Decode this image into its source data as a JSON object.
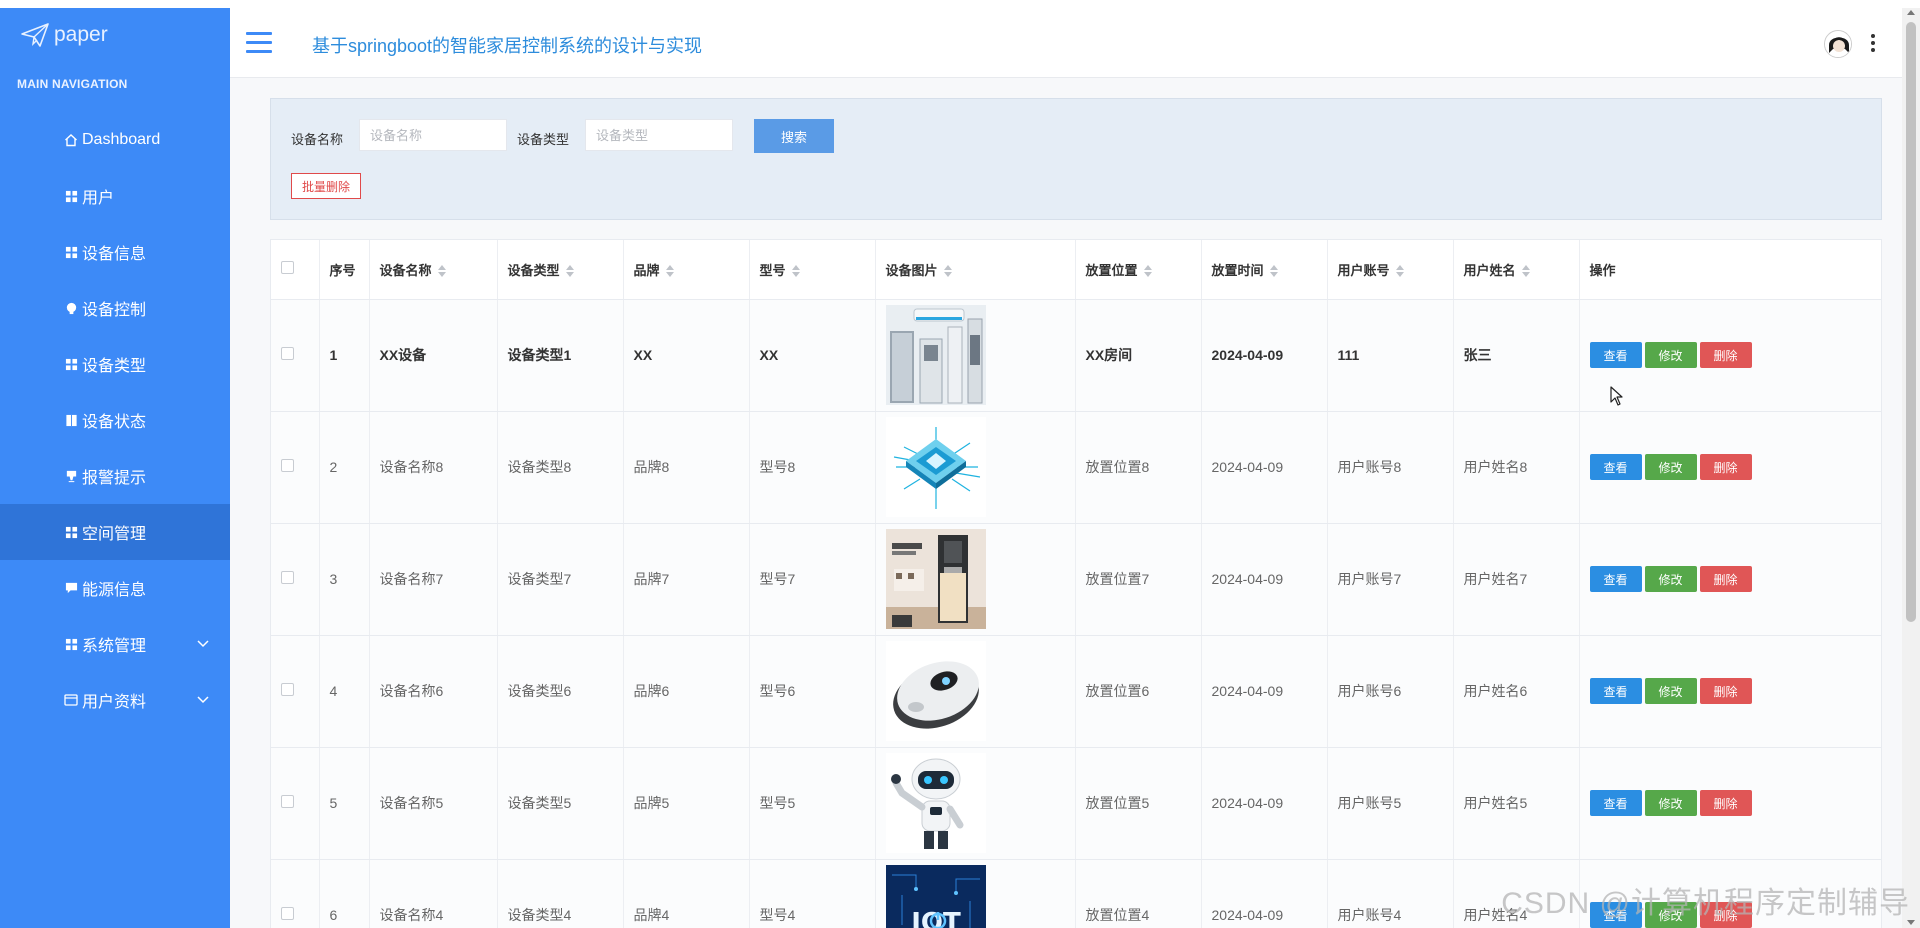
{
  "brand": {
    "name": "paper"
  },
  "sidebar": {
    "section_title": "MAIN NAVIGATION",
    "items": [
      {
        "label": "Dashboard",
        "icon": "home-icon"
      },
      {
        "label": "用户",
        "icon": "grid-icon"
      },
      {
        "label": "设备信息",
        "icon": "grid-icon"
      },
      {
        "label": "设备控制",
        "icon": "bulb-icon"
      },
      {
        "label": "设备类型",
        "icon": "grid-icon"
      },
      {
        "label": "设备状态",
        "icon": "book-icon"
      },
      {
        "label": "报警提示",
        "icon": "cup-icon"
      },
      {
        "label": "空间管理",
        "icon": "grid-icon",
        "active": true
      },
      {
        "label": "能源信息",
        "icon": "chat-icon"
      },
      {
        "label": "系统管理",
        "icon": "grid-icon",
        "expandable": true
      },
      {
        "label": "用户资料",
        "icon": "id-card-icon",
        "expandable": true
      }
    ]
  },
  "header": {
    "title": "基于springboot的智能家居控制系统的设计与实现"
  },
  "search": {
    "name_label": "设备名称",
    "name_placeholder": "设备名称",
    "type_label": "设备类型",
    "type_placeholder": "设备类型",
    "search_button": "搜索",
    "batch_delete_button": "批量删除"
  },
  "table": {
    "columns": [
      "",
      "序号",
      "设备名称",
      "设备类型",
      "品牌",
      "型号",
      "设备图片",
      "放置位置",
      "放置时间",
      "用户账号",
      "用户姓名",
      "操作"
    ],
    "actions": {
      "view": "查看",
      "edit": "修改",
      "delete": "删除"
    },
    "rows": [
      {
        "index": "1",
        "name": "XX设备",
        "type": "设备类型1",
        "brand": "XX",
        "model": "XX",
        "image": "appliances-image",
        "location": "XX房间",
        "time": "2024-04-09",
        "account": "111",
        "username": "张三"
      },
      {
        "index": "2",
        "name": "设备名称8",
        "type": "设备类型8",
        "brand": "品牌8",
        "model": "型号8",
        "image": "chip-image",
        "location": "放置位置8",
        "time": "2024-04-09",
        "account": "用户账号8",
        "username": "用户姓名8"
      },
      {
        "index": "3",
        "name": "设备名称7",
        "type": "设备类型7",
        "brand": "品牌7",
        "model": "型号7",
        "image": "water-dispenser-image",
        "location": "放置位置7",
        "time": "2024-04-09",
        "account": "用户账号7",
        "username": "用户姓名7"
      },
      {
        "index": "4",
        "name": "设备名称6",
        "type": "设备类型6",
        "brand": "品牌6",
        "model": "型号6",
        "image": "window-robot-image",
        "location": "放置位置6",
        "time": "2024-04-09",
        "account": "用户账号6",
        "username": "用户姓名6"
      },
      {
        "index": "5",
        "name": "设备名称5",
        "type": "设备类型5",
        "brand": "品牌5",
        "model": "型号5",
        "image": "robot-image",
        "location": "放置位置5",
        "time": "2024-04-09",
        "account": "用户账号5",
        "username": "用户姓名5"
      },
      {
        "index": "6",
        "name": "设备名称4",
        "type": "设备类型4",
        "brand": "品牌4",
        "model": "型号4",
        "image": "iot-image",
        "location": "放置位置4",
        "time": "2024-04-09",
        "account": "用户账号4",
        "username": "用户姓名4"
      }
    ]
  },
  "watermark": "CSDN @计算机程序定制辅导",
  "colors": {
    "sidebar": "#3d8af7",
    "sidebar_active": "#2f74d8",
    "title": "#2d8cdc",
    "view": "#2b8ee2",
    "edit": "#56a84a",
    "delete": "#e05656"
  }
}
